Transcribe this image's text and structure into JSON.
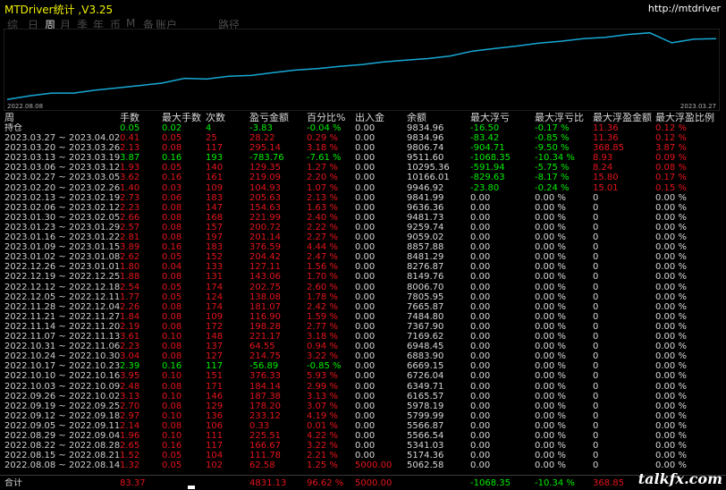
{
  "window": {
    "title": "MTDriver统计 ,V3.25",
    "url": "http://mtdriver"
  },
  "menu": [
    {
      "label": "综",
      "active": false
    },
    {
      "label": "日",
      "active": false
    },
    {
      "label": "周",
      "active": true
    },
    {
      "label": "月",
      "active": false
    },
    {
      "label": "季",
      "active": false
    },
    {
      "label": "年",
      "active": false
    },
    {
      "label": "币",
      "active": false
    },
    {
      "label": "M",
      "active": false
    },
    {
      "label": "备",
      "active": false
    },
    {
      "label": "账户",
      "active": false
    },
    {
      "label": "路径",
      "active": false
    }
  ],
  "chart_data": {
    "type": "line",
    "x_start_label": "2022.08.08",
    "x_end_label": "2023.03.27",
    "line_color": "#17a9d6",
    "grid": false,
    "series": [
      {
        "values": [
          5062.58,
          5341.03,
          5566.54,
          5566.87,
          5799.99,
          5978.19,
          6165.57,
          6349.71,
          6726.04,
          6669.15,
          6883.9,
          6948.45,
          7169.62,
          7367.9,
          7484.8,
          7665.87,
          7805.95,
          8006.7,
          8149.76,
          8276.87,
          8481.29,
          8857.88,
          9059.02,
          9259.74,
          9481.73,
          9636.36,
          9841.99,
          9946.92,
          10166.01,
          10295.36,
          9511.6,
          9806.74,
          9834.96
        ]
      }
    ]
  },
  "columns": [
    "周",
    "手数",
    "最大手数",
    "次数",
    "盈亏金额",
    "百分比%",
    "出入金",
    "余额",
    "最大浮亏",
    "最大浮亏比",
    "最大浮盈金额",
    "最大浮盈比例"
  ],
  "holding": {
    "label": "持仓",
    "lots": "0.05",
    "maxlots": "0.02",
    "count": "4",
    "pnl": "-3.83",
    "pct": "-0.04 %",
    "flow": "0.00",
    "balance": "9834.96",
    "maxdd": "-16.50",
    "maxddp": "-0.17 %",
    "maxfp": "11.36",
    "maxfpp": "0.12 %",
    "color": "green"
  },
  "rows": [
    {
      "week": "2023.03.27 ~ 2023.04.02",
      "lots": "0.41",
      "maxlots": "0.05",
      "count": "25",
      "pnl": "28.22",
      "pct": "0.29 %",
      "flow": "0.00",
      "balance": "9834.96",
      "maxdd": "-83.42",
      "maxddp": "-0.85 %",
      "maxfp": "11.36",
      "maxfpp": "0.12 %",
      "color": "red",
      "ddcolor": "green"
    },
    {
      "week": "2023.03.20 ~ 2023.03.26",
      "lots": "2.13",
      "maxlots": "0.08",
      "count": "117",
      "pnl": "295.14",
      "pct": "3.18 %",
      "flow": "0.00",
      "balance": "9806.74",
      "maxdd": "-904.71",
      "maxddp": "-9.50 %",
      "maxfp": "368.85",
      "maxfpp": "3.87 %",
      "color": "red",
      "ddcolor": "green"
    },
    {
      "week": "2023.03.13 ~ 2023.03.19",
      "lots": "3.87",
      "maxlots": "0.16",
      "count": "193",
      "pnl": "-783.76",
      "pct": "-7.61 %",
      "flow": "0.00",
      "balance": "9511.60",
      "maxdd": "-1068.35",
      "maxddp": "-10.34 %",
      "maxfp": "8.93",
      "maxfpp": "0.09 %",
      "color": "green",
      "ddcolor": "green"
    },
    {
      "week": "2023.03.06 ~ 2023.03.12",
      "lots": "1.93",
      "maxlots": "0.05",
      "count": "140",
      "pnl": "129.35",
      "pct": "1.27 %",
      "flow": "0.00",
      "balance": "10295.36",
      "maxdd": "-591.94",
      "maxddp": "-5.75 %",
      "maxfp": "8.24",
      "maxfpp": "0.08 %",
      "color": "red",
      "ddcolor": "green"
    },
    {
      "week": "2023.02.27 ~ 2023.03.05",
      "lots": "3.62",
      "maxlots": "0.16",
      "count": "161",
      "pnl": "219.09",
      "pct": "2.20 %",
      "flow": "0.00",
      "balance": "10166.01",
      "maxdd": "-829.63",
      "maxddp": "-8.17 %",
      "maxfp": "15.80",
      "maxfpp": "0.17 %",
      "color": "red",
      "ddcolor": "green"
    },
    {
      "week": "2023.02.20 ~ 2023.02.26",
      "lots": "1.40",
      "maxlots": "0.03",
      "count": "109",
      "pnl": "104.93",
      "pct": "1.07 %",
      "flow": "0.00",
      "balance": "9946.92",
      "maxdd": "-23.80",
      "maxddp": "-0.24 %",
      "maxfp": "15.01",
      "maxfpp": "0.15 %",
      "color": "red",
      "ddcolor": "green"
    },
    {
      "week": "2023.02.13 ~ 2023.02.19",
      "lots": "2.73",
      "maxlots": "0.06",
      "count": "183",
      "pnl": "205.63",
      "pct": "2.13 %",
      "flow": "0.00",
      "balance": "9841.99",
      "maxdd": "0.00",
      "maxddp": "0.00 %",
      "maxfp": "0",
      "maxfpp": "0.00 %",
      "color": "red",
      "ddcolor": "white"
    },
    {
      "week": "2023.02.06 ~ 2023.02.12",
      "lots": "2.23",
      "maxlots": "0.08",
      "count": "147",
      "pnl": "154.63",
      "pct": "1.63 %",
      "flow": "0.00",
      "balance": "9636.36",
      "maxdd": "0.00",
      "maxddp": "0.00 %",
      "maxfp": "0",
      "maxfpp": "0.00 %",
      "color": "red",
      "ddcolor": "white"
    },
    {
      "week": "2023.01.30 ~ 2023.02.05",
      "lots": "2.66",
      "maxlots": "0.08",
      "count": "168",
      "pnl": "221.99",
      "pct": "2.40 %",
      "flow": "0.00",
      "balance": "9481.73",
      "maxdd": "0.00",
      "maxddp": "0.00 %",
      "maxfp": "0",
      "maxfpp": "0.00 %",
      "color": "red",
      "ddcolor": "white"
    },
    {
      "week": "2023.01.23 ~ 2023.01.29",
      "lots": "2.57",
      "maxlots": "0.08",
      "count": "157",
      "pnl": "200.72",
      "pct": "2.22 %",
      "flow": "0.00",
      "balance": "9259.74",
      "maxdd": "0.00",
      "maxddp": "0.00 %",
      "maxfp": "0",
      "maxfpp": "0.00 %",
      "color": "red",
      "ddcolor": "white"
    },
    {
      "week": "2023.01.16 ~ 2023.01.22",
      "lots": "2.81",
      "maxlots": "0.08",
      "count": "197",
      "pnl": "201.14",
      "pct": "2.27 %",
      "flow": "0.00",
      "balance": "9059.02",
      "maxdd": "0.00",
      "maxddp": "0.00 %",
      "maxfp": "0",
      "maxfpp": "0.00 %",
      "color": "red",
      "ddcolor": "white"
    },
    {
      "week": "2023.01.09 ~ 2023.01.15",
      "lots": "3.89",
      "maxlots": "0.16",
      "count": "183",
      "pnl": "376.59",
      "pct": "4.44 %",
      "flow": "0.00",
      "balance": "8857.88",
      "maxdd": "0.00",
      "maxddp": "0.00 %",
      "maxfp": "0",
      "maxfpp": "0.00 %",
      "color": "red",
      "ddcolor": "white"
    },
    {
      "week": "2023.01.02 ~ 2023.01.08",
      "lots": "2.62",
      "maxlots": "0.05",
      "count": "152",
      "pnl": "204.42",
      "pct": "2.47 %",
      "flow": "0.00",
      "balance": "8481.29",
      "maxdd": "0.00",
      "maxddp": "0.00 %",
      "maxfp": "0",
      "maxfpp": "0.00 %",
      "color": "red",
      "ddcolor": "white"
    },
    {
      "week": "2022.12.26 ~ 2023.01.01",
      "lots": "1.80",
      "maxlots": "0.04",
      "count": "133",
      "pnl": "127.11",
      "pct": "1.56 %",
      "flow": "0.00",
      "balance": "8276.87",
      "maxdd": "0.00",
      "maxddp": "0.00 %",
      "maxfp": "0",
      "maxfpp": "0.00 %",
      "color": "red",
      "ddcolor": "white"
    },
    {
      "week": "2022.12.19 ~ 2022.12.25",
      "lots": "1.88",
      "maxlots": "0.08",
      "count": "131",
      "pnl": "143.06",
      "pct": "1.70 %",
      "flow": "0.00",
      "balance": "8149.76",
      "maxdd": "0.00",
      "maxddp": "0.00 %",
      "maxfp": "0",
      "maxfpp": "0.00 %",
      "color": "red",
      "ddcolor": "white"
    },
    {
      "week": "2022.12.12 ~ 2022.12.18",
      "lots": "2.54",
      "maxlots": "0.05",
      "count": "174",
      "pnl": "202.75",
      "pct": "2.60 %",
      "flow": "0.00",
      "balance": "8006.70",
      "maxdd": "0.00",
      "maxddp": "0.00 %",
      "maxfp": "0",
      "maxfpp": "0.00 %",
      "color": "red",
      "ddcolor": "white"
    },
    {
      "week": "2022.12.05 ~ 2022.12.11",
      "lots": "1.77",
      "maxlots": "0.05",
      "count": "124",
      "pnl": "138.08",
      "pct": "1.78 %",
      "flow": "0.00",
      "balance": "7805.95",
      "maxdd": "0.00",
      "maxddp": "0.00 %",
      "maxfp": "0",
      "maxfpp": "0.00 %",
      "color": "red",
      "ddcolor": "white"
    },
    {
      "week": "2022.11.28 ~ 2022.12.04",
      "lots": "2.26",
      "maxlots": "0.08",
      "count": "174",
      "pnl": "181.07",
      "pct": "2.42 %",
      "flow": "0.00",
      "balance": "7665.87",
      "maxdd": "0.00",
      "maxddp": "0.00 %",
      "maxfp": "0",
      "maxfpp": "0.00 %",
      "color": "red",
      "ddcolor": "white"
    },
    {
      "week": "2022.11.21 ~ 2022.11.27",
      "lots": "1.84",
      "maxlots": "0.08",
      "count": "109",
      "pnl": "116.90",
      "pct": "1.59 %",
      "flow": "0.00",
      "balance": "7484.80",
      "maxdd": "0.00",
      "maxddp": "0.00 %",
      "maxfp": "0",
      "maxfpp": "0.00 %",
      "color": "red",
      "ddcolor": "white"
    },
    {
      "week": "2022.11.14 ~ 2022.11.20",
      "lots": "2.19",
      "maxlots": "0.08",
      "count": "172",
      "pnl": "198.28",
      "pct": "2.77 %",
      "flow": "0.00",
      "balance": "7367.90",
      "maxdd": "0.00",
      "maxddp": "0.00 %",
      "maxfp": "0",
      "maxfpp": "0.00 %",
      "color": "red",
      "ddcolor": "white"
    },
    {
      "week": "2022.11.07 ~ 2022.11.13",
      "lots": "3.61",
      "maxlots": "0.10",
      "count": "148",
      "pnl": "221.17",
      "pct": "3.18 %",
      "flow": "0.00",
      "balance": "7169.62",
      "maxdd": "0.00",
      "maxddp": "0.00 %",
      "maxfp": "0",
      "maxfpp": "0.00 %",
      "color": "red",
      "ddcolor": "white"
    },
    {
      "week": "2022.10.31 ~ 2022.11.06",
      "lots": "2.23",
      "maxlots": "0.08",
      "count": "137",
      "pnl": "64.55",
      "pct": "0.94 %",
      "flow": "0.00",
      "balance": "6948.45",
      "maxdd": "0.00",
      "maxddp": "0.00 %",
      "maxfp": "0",
      "maxfpp": "0.00 %",
      "color": "red",
      "ddcolor": "white"
    },
    {
      "week": "2022.10.24 ~ 2022.10.30",
      "lots": "3.04",
      "maxlots": "0.08",
      "count": "127",
      "pnl": "214.75",
      "pct": "3.22 %",
      "flow": "0.00",
      "balance": "6883.90",
      "maxdd": "0.00",
      "maxddp": "0.00 %",
      "maxfp": "0",
      "maxfpp": "0.00 %",
      "color": "red",
      "ddcolor": "white"
    },
    {
      "week": "2022.10.17 ~ 2022.10.23",
      "lots": "2.39",
      "maxlots": "0.16",
      "count": "117",
      "pnl": "-56.89",
      "pct": "-0.85 %",
      "flow": "0.00",
      "balance": "6669.15",
      "maxdd": "0.00",
      "maxddp": "0.00 %",
      "maxfp": "0",
      "maxfpp": "0.00 %",
      "color": "green",
      "ddcolor": "white"
    },
    {
      "week": "2022.10.10 ~ 2022.10.16",
      "lots": "3.95",
      "maxlots": "0.10",
      "count": "151",
      "pnl": "376.33",
      "pct": "5.93 %",
      "flow": "0.00",
      "balance": "6726.04",
      "maxdd": "0.00",
      "maxddp": "0.00 %",
      "maxfp": "0",
      "maxfpp": "0.00 %",
      "color": "red",
      "ddcolor": "white"
    },
    {
      "week": "2022.10.03 ~ 2022.10.09",
      "lots": "2.48",
      "maxlots": "0.08",
      "count": "171",
      "pnl": "184.14",
      "pct": "2.99 %",
      "flow": "0.00",
      "balance": "6349.71",
      "maxdd": "0.00",
      "maxddp": "0.00 %",
      "maxfp": "0",
      "maxfpp": "0.00 %",
      "color": "red",
      "ddcolor": "white"
    },
    {
      "week": "2022.09.26 ~ 2022.10.02",
      "lots": "3.13",
      "maxlots": "0.10",
      "count": "146",
      "pnl": "187.38",
      "pct": "3.13 %",
      "flow": "0.00",
      "balance": "6165.57",
      "maxdd": "0.00",
      "maxddp": "0.00 %",
      "maxfp": "0",
      "maxfpp": "0.00 %",
      "color": "red",
      "ddcolor": "white"
    },
    {
      "week": "2022.09.19 ~ 2022.09.25",
      "lots": "2.70",
      "maxlots": "0.08",
      "count": "129",
      "pnl": "178.20",
      "pct": "3.07 %",
      "flow": "0.00",
      "balance": "5978.19",
      "maxdd": "0.00",
      "maxddp": "0.00 %",
      "maxfp": "0",
      "maxfpp": "0.00 %",
      "color": "red",
      "ddcolor": "white"
    },
    {
      "week": "2022.09.12 ~ 2022.09.18",
      "lots": "2.97",
      "maxlots": "0.10",
      "count": "136",
      "pnl": "233.12",
      "pct": "4.19 %",
      "flow": "0.00",
      "balance": "5799.99",
      "maxdd": "0.00",
      "maxddp": "0.00 %",
      "maxfp": "0",
      "maxfpp": "0.00 %",
      "color": "red",
      "ddcolor": "white"
    },
    {
      "week": "2022.09.05 ~ 2022.09.11",
      "lots": "2.14",
      "maxlots": "0.08",
      "count": "106",
      "pnl": "0.33",
      "pct": "0.01 %",
      "flow": "0.00",
      "balance": "5566.87",
      "maxdd": "0.00",
      "maxddp": "0.00 %",
      "maxfp": "0",
      "maxfpp": "0.00 %",
      "color": "red",
      "ddcolor": "white"
    },
    {
      "week": "2022.08.29 ~ 2022.09.04",
      "lots": "1.96",
      "maxlots": "0.10",
      "count": "111",
      "pnl": "225.51",
      "pct": "4.22 %",
      "flow": "0.00",
      "balance": "5566.54",
      "maxdd": "0.00",
      "maxddp": "0.00 %",
      "maxfp": "0",
      "maxfpp": "0.00 %",
      "color": "red",
      "ddcolor": "white"
    },
    {
      "week": "2022.08.22 ~ 2022.08.28",
      "lots": "2.65",
      "maxlots": "0.16",
      "count": "117",
      "pnl": "166.67",
      "pct": "3.22 %",
      "flow": "0.00",
      "balance": "5341.03",
      "maxdd": "0.00",
      "maxddp": "0.00 %",
      "maxfp": "0",
      "maxfpp": "0.00 %",
      "color": "red",
      "ddcolor": "white"
    },
    {
      "week": "2022.08.15 ~ 2022.08.21",
      "lots": "1.52",
      "maxlots": "0.05",
      "count": "104",
      "pnl": "111.78",
      "pct": "2.21 %",
      "flow": "0.00",
      "balance": "5174.36",
      "maxdd": "0.00",
      "maxddp": "0.00 %",
      "maxfp": "0",
      "maxfpp": "0.00 %",
      "color": "red",
      "ddcolor": "white"
    },
    {
      "week": "2022.08.08 ~ 2022.08.14",
      "lots": "1.32",
      "maxlots": "0.05",
      "count": "102",
      "pnl": "62.58",
      "pct": "1.25 %",
      "flow": "5000.00",
      "balance": "5062.58",
      "maxdd": "0.00",
      "maxddp": "0.00 %",
      "maxfp": "0",
      "maxfpp": "0.00 %",
      "color": "red",
      "ddcolor": "white"
    }
  ],
  "total": {
    "label": "合计",
    "lots": "83.37",
    "pnl": "4831.13",
    "pct": "96.62 %",
    "flow": "5000.00",
    "maxdd": "-1068.35",
    "maxddp": "-10.34 %",
    "maxfp": "368.85"
  },
  "watermark": "talkfx.com",
  "colors": {
    "green": "#00ee00",
    "red": "#e5141c",
    "title": "#f0f000",
    "line": "#17a9d6"
  }
}
